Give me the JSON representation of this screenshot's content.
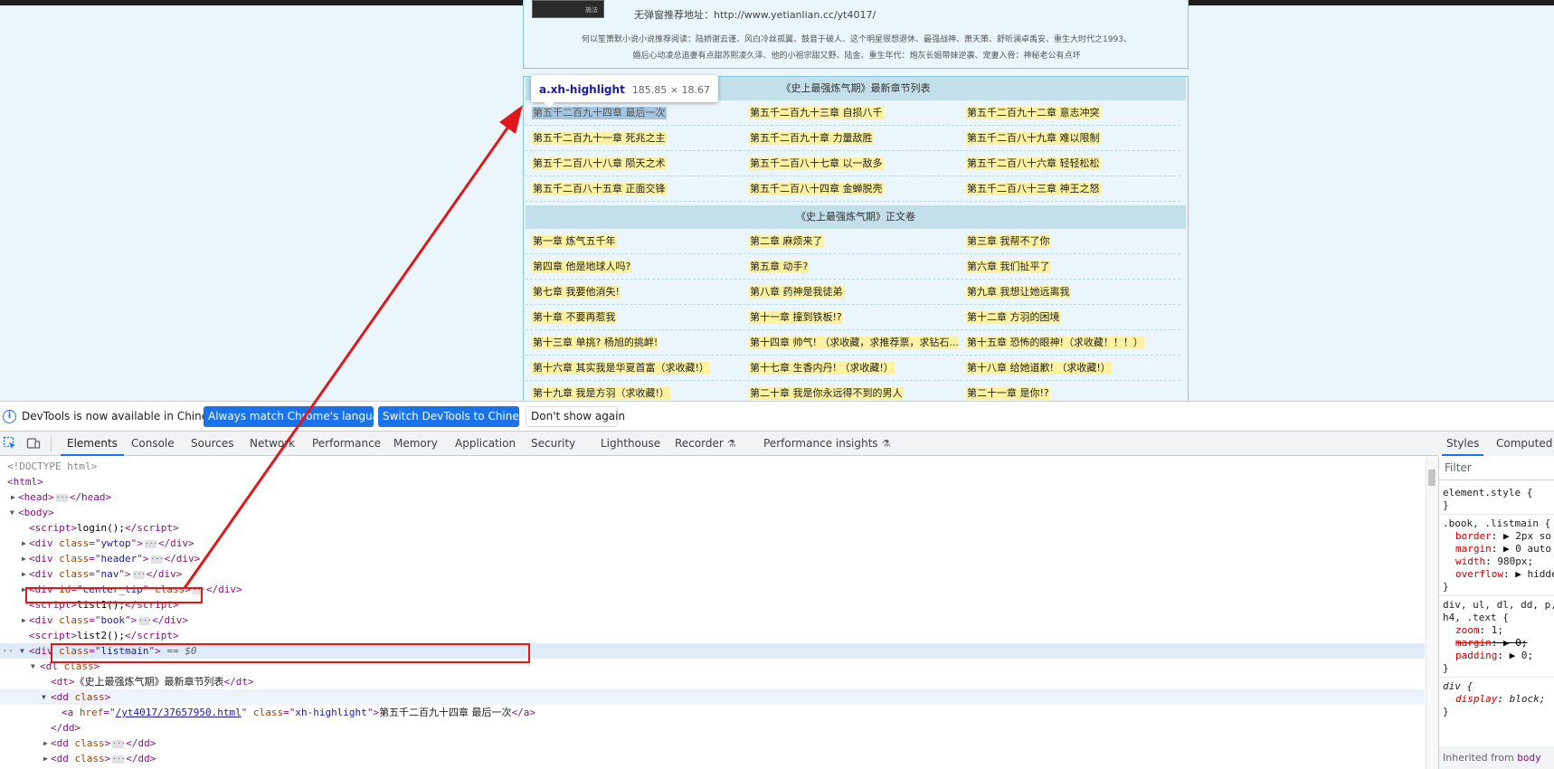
{
  "page": {
    "book_thumb_label": "施法",
    "recommend_text": "无弹窗推荐地址：http://www.yetianlian.cc/yt4017/",
    "desc_line1": "何以笙箫默小说小说推荐阅读：陆娇谢云谨、风白冷丝孤翼、鼓音于破人、这个明星很想退休、最强战神、萧天策、舒听澜卓禹安、重生大时代之1993、",
    "desc_line2": "婚后心动凌总追妻有点甜苏熙凌久泽、他的小祖宗甜又野、陆金、重生年代：炮灰长姐带妹逆袭、宠妻入骨：神秘老公有点坏",
    "latest_header": "《史上最强炼气期》最新章节列表",
    "main_header": "《史上最强炼气期》正文卷",
    "latest_rows": [
      [
        "第五千二百九十四章 最后一次",
        "第五千二百九十三章 自损八千",
        "第五千二百九十二章 意志冲突"
      ],
      [
        "第五千二百九十一章 死兆之主",
        "第五千二百九十章 力量敌胜",
        "第五千二百八十九章 难以限制"
      ],
      [
        "第五千二百八十八章 陨天之术",
        "第五千二百八十七章 以一敌多",
        "第五千二百八十六章 轻轻松松"
      ],
      [
        "第五千二百八十五章 正面交锋",
        "第五千二百八十四章 金蝉脱壳",
        "第五千二百八十三章 神王之怒"
      ]
    ],
    "main_rows": [
      [
        "第一章 炼气五千年",
        "第二章 麻烦来了",
        "第三章 我帮不了你"
      ],
      [
        "第四章 他是地球人吗?",
        "第五章 动手?",
        "第六章 我们扯平了"
      ],
      [
        "第七章 我要他消失!",
        "第八章 药神是我徒弟",
        "第九章 我想让她远离我"
      ],
      [
        "第十章 不要再惹我",
        "第十一章 撞到铁板!?",
        "第十二章 方羽的困境"
      ],
      [
        "第十三章 单挑? 杨旭的挑衅!",
        "第十四章 帅气! （求收藏，求推荐票，求钻石...",
        "第十五章 恐怖的眼神!（求收藏！！！）"
      ],
      [
        "第十六章 其实我是华夏首富（求收藏!）",
        "第十七章 生香内丹! （求收藏!）",
        "第十八章 给她道歉! （求收藏!）"
      ],
      [
        "第十九章 我是方羽（求收藏!）",
        "第二十章 我是你永远得不到的男人",
        "第二十一章 是你!?"
      ]
    ]
  },
  "tooltip": {
    "name": "a.xh-highlight",
    "size": "185.85 × 18.67"
  },
  "infobar": {
    "message": "DevTools is now available in Chinese!",
    "btn_match": "Always match Chrome's language",
    "btn_switch": "Switch DevTools to Chinese",
    "btn_dismiss": "Don't show again"
  },
  "tabs": [
    "Elements",
    "Console",
    "Sources",
    "Network",
    "Performance",
    "Memory",
    "Application",
    "Security",
    "Lighthouse",
    "Recorder",
    "Performance insights"
  ],
  "elements": {
    "doctype": "<!DOCTYPE html>",
    "l_html": "<html>",
    "l_head": "<head>",
    "l_head_close": "</head>",
    "l_body": "<body>",
    "l_script_login": "login();",
    "l_div_ywtop": "ywtop",
    "l_div_header": "header",
    "l_div_nav": "nav",
    "l_div_center_tip": "center_tip",
    "l_script_list1": "list1();",
    "l_div_book": "book",
    "l_script_list2": "list2();",
    "l_div_listmain": "listmain",
    "selected_marker": "== $0",
    "dt_text": "《史上最强炼气期》最新章节列表",
    "href": "/yt4017/37657950.html",
    "a_class": "xh-highlight",
    "a_text": "第五千二百九十四章  最后一次"
  },
  "styles": {
    "tab_styles": "Styles",
    "tab_computed": "Computed",
    "filter_placeholder": "Filter",
    "inherited_label": "Inherited from",
    "inherited_tag": "body"
  },
  "colors": {
    "highlight_red": "#e0181b",
    "accent_blue": "#1a73e8",
    "page_bg": "#eaf5fc",
    "chapter_highlight": "#fdf2a1"
  }
}
